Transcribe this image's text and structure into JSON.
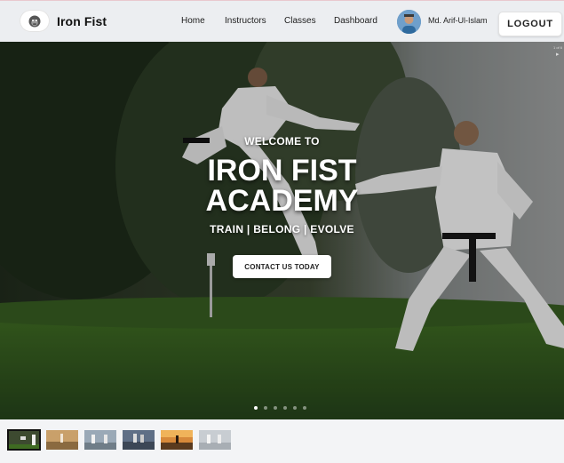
{
  "brand": {
    "name": "Iron Fist",
    "logo_icon": "gorilla-icon"
  },
  "nav": {
    "links": [
      "Home",
      "Instructors",
      "Classes",
      "Dashboard"
    ]
  },
  "user": {
    "name": "Md. Arif-Ul-Islam",
    "avatar_icon": "user-avatar"
  },
  "logout_label": "LOGOUT",
  "hero": {
    "welcome": "WELCOME TO",
    "title_line1": "IRON FIST",
    "title_line2": "ACADEMY",
    "tagline": "TRAIN | BELONG | EVOLVE",
    "cta_label": "CONTACT US TODAY",
    "counter": "1 of 6",
    "next_icon": "chevron-right-icon",
    "slide_count": 6,
    "active_slide": 1
  },
  "thumbnails": {
    "count": 6,
    "active_index": 0,
    "colors": [
      "#3d4a30",
      "#c9a06a",
      "#9aa9b7",
      "#5f6f86",
      "#d7893a",
      "#c8cdd2"
    ]
  },
  "colors": {
    "navbar_bg": "#eceef1",
    "page_bg": "#f3f4f6",
    "accent_white": "#ffffff"
  }
}
